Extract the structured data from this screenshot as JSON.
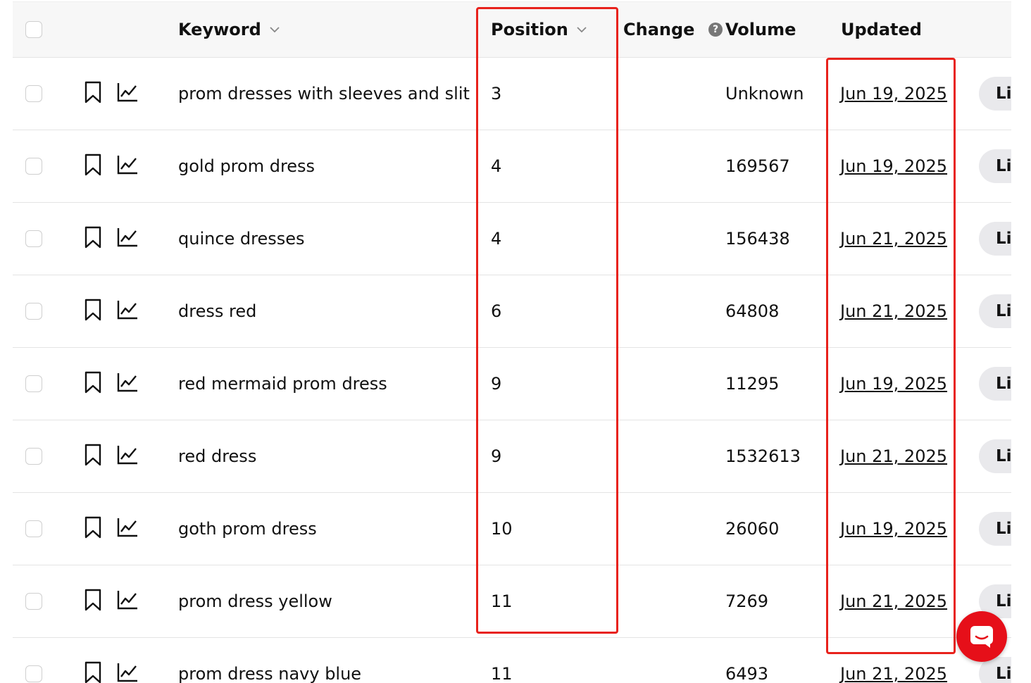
{
  "header": {
    "keyword": "Keyword",
    "position": "Position",
    "change": "Change",
    "volume": "Volume",
    "volume_info": "?",
    "updated": "Updated"
  },
  "rows": [
    {
      "keyword": "prom dresses with sleeves and slit",
      "position": "3",
      "change": "",
      "volume": "Unknown",
      "updated": "Jun 19, 2025",
      "action": "Li"
    },
    {
      "keyword": "gold prom dress",
      "position": "4",
      "change": "",
      "volume": "169567",
      "updated": "Jun 19, 2025",
      "action": "Li"
    },
    {
      "keyword": "quince dresses",
      "position": "4",
      "change": "",
      "volume": "156438",
      "updated": "Jun 21, 2025",
      "action": "Li"
    },
    {
      "keyword": "dress red",
      "position": "6",
      "change": "",
      "volume": "64808",
      "updated": "Jun 21, 2025",
      "action": "Li"
    },
    {
      "keyword": "red mermaid prom dress",
      "position": "9",
      "change": "",
      "volume": "11295",
      "updated": "Jun 19, 2025",
      "action": "Li"
    },
    {
      "keyword": "red dress",
      "position": "9",
      "change": "",
      "volume": "1532613",
      "updated": "Jun 21, 2025",
      "action": "Li"
    },
    {
      "keyword": "goth prom dress",
      "position": "10",
      "change": "",
      "volume": "26060",
      "updated": "Jun 19, 2025",
      "action": "Li"
    },
    {
      "keyword": "prom dress yellow",
      "position": "11",
      "change": "",
      "volume": "7269",
      "updated": "Jun 21, 2025",
      "action": "Li"
    },
    {
      "keyword": "prom dress navy blue",
      "position": "11",
      "change": "",
      "volume": "6493",
      "updated": "Jun 21, 2025",
      "action": "Li"
    }
  ],
  "colors": {
    "highlight": "#e8221c",
    "chat_button": "#e60f19",
    "header_bg": "#f7f7f7",
    "pill_bg": "#e9e9ec"
  },
  "icons": {
    "bookmark": "bookmark-icon",
    "trend": "trend-chart-icon",
    "chat": "chat-icon",
    "sort": "chevron-down-icon",
    "info": "info-icon"
  }
}
